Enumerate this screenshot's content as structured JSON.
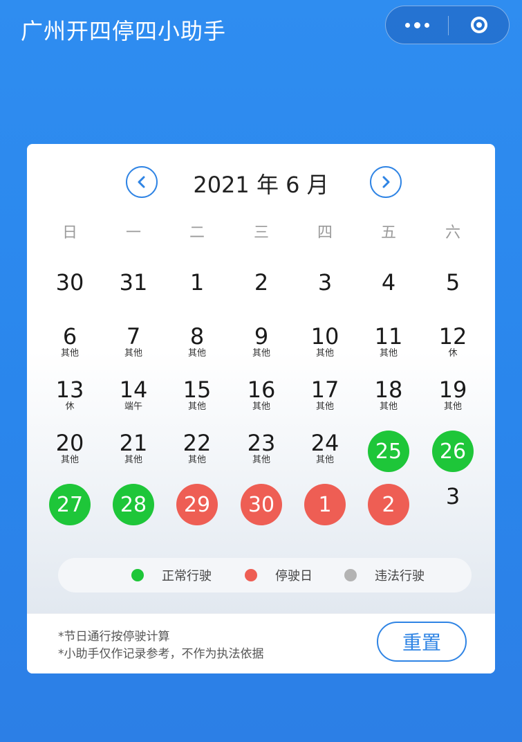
{
  "header": {
    "title": "广州开四停四小助手"
  },
  "capsule": {
    "more_icon": "more-dots-icon",
    "close_icon": "target-circle-icon"
  },
  "calendar": {
    "title": "2021 年 6 月",
    "prev_icon": "chevron-left-icon",
    "next_icon": "chevron-right-icon",
    "weekdays": [
      "日",
      "一",
      "二",
      "三",
      "四",
      "五",
      "六"
    ],
    "status_colors": {
      "normal": "#1ec639",
      "stop": "#ee5e54",
      "illegal": "#b3b3b3"
    },
    "weeks": [
      [
        {
          "day": "30",
          "note": ""
        },
        {
          "day": "31",
          "note": ""
        },
        {
          "day": "1",
          "note": ""
        },
        {
          "day": "2",
          "note": ""
        },
        {
          "day": "3",
          "note": ""
        },
        {
          "day": "4",
          "note": ""
        },
        {
          "day": "5",
          "note": ""
        }
      ],
      [
        {
          "day": "6",
          "note": "其他"
        },
        {
          "day": "7",
          "note": "其他"
        },
        {
          "day": "8",
          "note": "其他"
        },
        {
          "day": "9",
          "note": "其他"
        },
        {
          "day": "10",
          "note": "其他"
        },
        {
          "day": "11",
          "note": "其他"
        },
        {
          "day": "12",
          "note": "休"
        }
      ],
      [
        {
          "day": "13",
          "note": "休"
        },
        {
          "day": "14",
          "note": "端午"
        },
        {
          "day": "15",
          "note": "其他"
        },
        {
          "day": "16",
          "note": "其他"
        },
        {
          "day": "17",
          "note": "其他"
        },
        {
          "day": "18",
          "note": "其他"
        },
        {
          "day": "19",
          "note": "其他"
        }
      ],
      [
        {
          "day": "20",
          "note": "其他"
        },
        {
          "day": "21",
          "note": "其他"
        },
        {
          "day": "22",
          "note": "其他"
        },
        {
          "day": "23",
          "note": "其他"
        },
        {
          "day": "24",
          "note": "其他"
        },
        {
          "day": "25",
          "note": "",
          "status": "normal"
        },
        {
          "day": "26",
          "note": "",
          "status": "normal"
        }
      ],
      [
        {
          "day": "27",
          "note": "",
          "status": "normal"
        },
        {
          "day": "28",
          "note": "",
          "status": "normal"
        },
        {
          "day": "29",
          "note": "",
          "status": "stop"
        },
        {
          "day": "30",
          "note": "",
          "status": "stop"
        },
        {
          "day": "1",
          "note": "",
          "status": "stop"
        },
        {
          "day": "2",
          "note": "",
          "status": "stop"
        },
        {
          "day": "3",
          "note": ""
        }
      ]
    ]
  },
  "legend": {
    "items": [
      {
        "label": "正常行驶",
        "color": "#1ec639"
      },
      {
        "label": "停驶日",
        "color": "#ee5e54"
      },
      {
        "label": "违法行驶",
        "color": "#b3b3b3"
      }
    ]
  },
  "footer": {
    "notes": [
      "*节日通行按停驶计算",
      "*小助手仅作记录参考，不作为执法依据"
    ],
    "reset_label": "重置"
  }
}
